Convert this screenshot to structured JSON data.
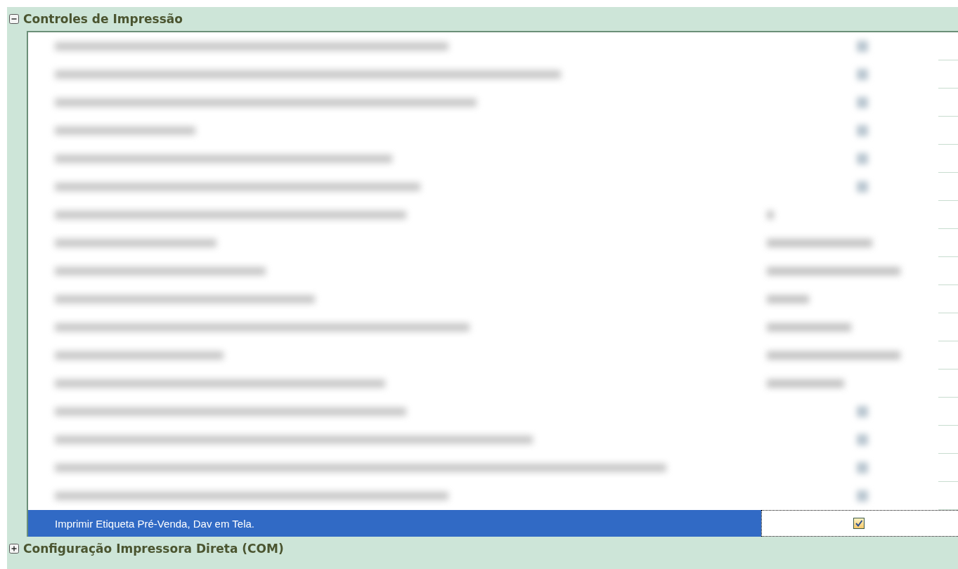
{
  "groups": [
    {
      "title": "Controles de Impressão",
      "expanded": true,
      "rows": [
        {
          "kind": "check",
          "blurred": true,
          "selected": false
        },
        {
          "kind": "check",
          "blurred": true,
          "selected": false
        },
        {
          "kind": "check",
          "blurred": true,
          "selected": false
        },
        {
          "kind": "check",
          "blurred": true,
          "selected": false
        },
        {
          "kind": "check",
          "blurred": true,
          "selected": false
        },
        {
          "kind": "check",
          "blurred": true,
          "selected": false
        },
        {
          "kind": "text",
          "blurred": true,
          "selected": false
        },
        {
          "kind": "text",
          "blurred": true,
          "selected": false
        },
        {
          "kind": "text",
          "blurred": true,
          "selected": false
        },
        {
          "kind": "text",
          "blurred": true,
          "selected": false
        },
        {
          "kind": "text",
          "blurred": true,
          "selected": false
        },
        {
          "kind": "text",
          "blurred": true,
          "selected": false
        },
        {
          "kind": "text",
          "blurred": true,
          "selected": false
        },
        {
          "kind": "check",
          "blurred": true,
          "selected": false
        },
        {
          "kind": "check",
          "blurred": true,
          "selected": false
        },
        {
          "kind": "check",
          "blurred": true,
          "selected": false
        },
        {
          "kind": "check",
          "blurred": true,
          "selected": false
        },
        {
          "kind": "check",
          "blurred": false,
          "selected": true,
          "label": "Imprimir Etiqueta Pré-Venda, Dav em Tela.",
          "checked": true
        }
      ]
    },
    {
      "title": "Configuração Impressora Direta (COM)",
      "expanded": false
    }
  ]
}
